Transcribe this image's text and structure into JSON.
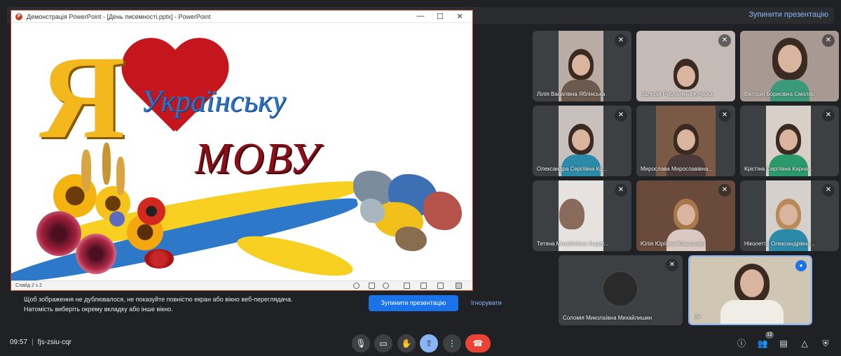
{
  "top_bar": {
    "stop_label": "Зупинити презентацію"
  },
  "ppt_window": {
    "title": "Демонстрація PowerPoint - [День писемності.pptx] - PowerPoint",
    "slide_counter": "Слайд 2 з 2",
    "slide": {
      "letter": "Я",
      "line1": "Українську",
      "line2": "МОВУ"
    }
  },
  "notice": {
    "text": "Щоб зображення не дублювалося, не показуйте повністю екран або вікно веб-переглядача. Натомість виберіть окрему вкладку або інше вікно.",
    "stop_button": "Зупинити презентацію",
    "ignore_button": "Ігнорувати"
  },
  "participants": [
    {
      "name": "Лілія Василівна Яблінська"
    },
    {
      "name": "Валерія Русланівна Кучірка"
    },
    {
      "name": "Вікторія Борисівна Смоляр"
    },
    {
      "name": "Олександра Сергіївна Кр..."
    },
    {
      "name": "Мирослава Мирославівна..."
    },
    {
      "name": "Крістіна Сергіївна Карна..."
    },
    {
      "name": "Тетяна Михайлівна Андру..."
    },
    {
      "name": "Юлія Юріївна Ковальова"
    },
    {
      "name": "Ніколетта Олександрівна..."
    },
    {
      "name": "Соломія Миколаївна Михайлишин"
    },
    {
      "name": "Ви"
    }
  ],
  "bottom_bar": {
    "time": "09:57",
    "meeting_code": "fjs-zsiu-cqr",
    "participant_count": "12"
  },
  "colors": {
    "accent": "#8ab4f8",
    "primary_button": "#1a73e8",
    "end_call": "#ea4335",
    "ppt_brand": "#c43e1c"
  }
}
